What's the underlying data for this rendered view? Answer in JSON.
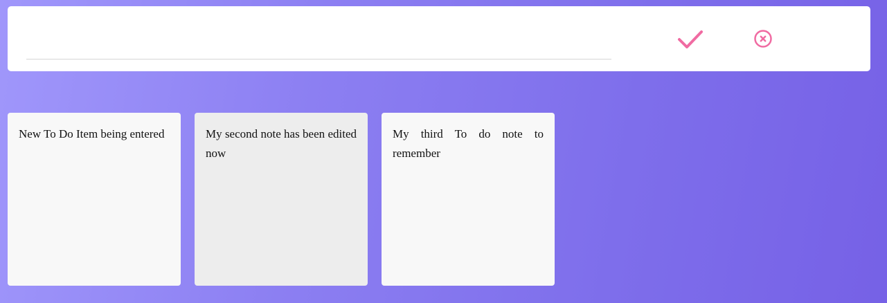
{
  "composer": {
    "input_value": "",
    "input_placeholder": "",
    "confirm_icon": "checkmark-icon",
    "cancel_icon": "circle-x-icon",
    "accent_color": "#f06ba2"
  },
  "notes": [
    {
      "text": "New To Do Item being entered",
      "selected": false
    },
    {
      "text": "My second note has been edited now",
      "selected": true
    },
    {
      "text": "My third To do note to remember",
      "selected": false
    }
  ],
  "colors": {
    "background_start": "#a097fb",
    "background_end": "#7661e6",
    "card_bg": "#f8f8f8",
    "card_selected_bg": "#ededed"
  }
}
